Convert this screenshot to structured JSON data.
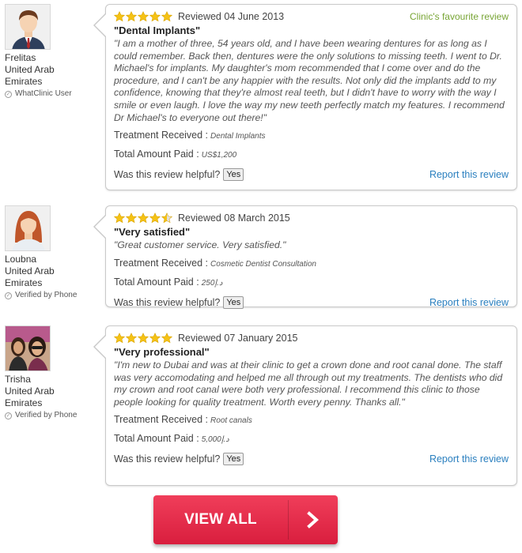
{
  "colors": {
    "accent_green": "#78a535",
    "link_blue": "#2a7fbf",
    "star_gold": "#f5c215",
    "button_red": "#e32c4a"
  },
  "reviews": [
    {
      "reviewer": {
        "name": "Frelitas",
        "location_line1": "United Arab",
        "location_line2": "Emirates",
        "verification": "WhatClinic User",
        "avatar_icon": "male-avatar-icon"
      },
      "rating": 5,
      "date_text": "Reviewed 04 June 2013",
      "badge": "Clinic's favourite review",
      "title": "\"Dental Implants\"",
      "text": "\"I am a mother of three, 54 years old, and I have been wearing dentures for as long as I could remember. Back then, dentures were the only solutions to missing teeth. I went to Dr. Michael's for implants. My daughter's mom recommended that I come over and do the procedure, and I can't be any happier with the results. Not only did the implants add to my confidence, knowing that they're almost real teeth, but I didn't have to worry with the way I smile or even laugh. I love the way my new teeth perfectly match my features. I recommend Dr Michael's to everyone out there!\"",
      "treatment_label": "Treatment Received :",
      "treatment": "Dental Implants",
      "amount_label": "Total Amount Paid :",
      "amount": "US$1,200",
      "helpful_label": "Was this review helpful?",
      "yes_label": "Yes",
      "report_label": "Report this review"
    },
    {
      "reviewer": {
        "name": "Loubna",
        "location_line1": "United Arab",
        "location_line2": "Emirates",
        "verification": "Verified by Phone",
        "avatar_icon": "female-avatar-icon"
      },
      "rating": 4.5,
      "date_text": "Reviewed 08 March 2015",
      "badge": "",
      "title": "\"Very satisfied\"",
      "text": "\"Great customer service. Very satisfied.\"",
      "treatment_label": "Treatment Received :",
      "treatment": "Cosmetic Dentist Consultation",
      "amount_label": "Total Amount Paid :",
      "amount": "د.إ250",
      "helpful_label": "Was this review helpful?",
      "yes_label": "Yes",
      "report_label": "Report this review"
    },
    {
      "reviewer": {
        "name": "Trisha",
        "location_line1": "United Arab",
        "location_line2": "Emirates",
        "verification": "Verified by Phone",
        "avatar_icon": "photo-avatar-icon"
      },
      "rating": 5,
      "date_text": "Reviewed 07 January 2015",
      "badge": "",
      "title": "\"Very professional\"",
      "text": "\"I'm new to Dubai and was at their clinic to get a crown done and root canal done. The staff was very accomodating and helped me all through out my treatments. The dentists who did my crown and root canal were both very professional. I recommend this clinic to those people looking for quality treatment. Worth every penny. Thanks all.\"",
      "treatment_label": "Treatment Received :",
      "treatment": "Root canals",
      "amount_label": "Total Amount Paid :",
      "amount": "د.إ5,000",
      "helpful_label": "Was this review helpful?",
      "yes_label": "Yes",
      "report_label": "Report this review"
    }
  ],
  "view_all": {
    "label": "VIEW ALL",
    "icon": "chevron-right-icon"
  }
}
